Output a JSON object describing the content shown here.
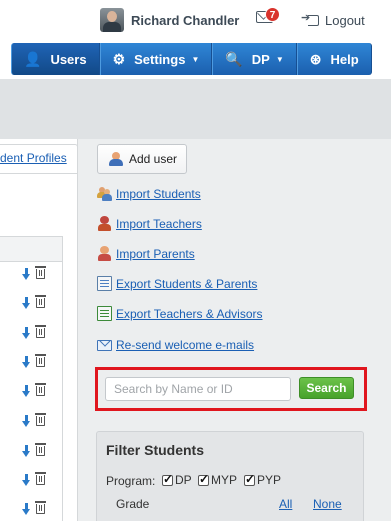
{
  "header": {
    "user_name": "Richard Chandler",
    "messages_badge": "7",
    "logout_label": "Logout"
  },
  "nav": {
    "items": [
      {
        "label": "Users",
        "icon": "user-icon"
      },
      {
        "label": "Settings",
        "icon": "gear-icon",
        "dropdown": true
      },
      {
        "label": "DP",
        "icon": "search-icon",
        "dropdown": true
      },
      {
        "label": "Help",
        "icon": "lifebuoy-icon"
      }
    ]
  },
  "left_panel": {
    "tab_label": "dent Profiles",
    "row_count": 9
  },
  "actions": {
    "add_user_label": "Add user",
    "links": [
      {
        "label": "Import Students",
        "icon": "people-icon"
      },
      {
        "label": "Import Teachers",
        "icon": "teacher-icon"
      },
      {
        "label": "Import Parents",
        "icon": "parent-icon"
      },
      {
        "label": "Export Students & Parents",
        "icon": "export-sheet-icon"
      },
      {
        "label": "Export Teachers & Advisors",
        "icon": "export-sheet-green-icon"
      },
      {
        "label": "Re-send welcome e-mails",
        "icon": "mail-icon"
      }
    ]
  },
  "search": {
    "placeholder": "Search by Name or ID",
    "value": "",
    "button_label": "Search"
  },
  "filter": {
    "title": "Filter Students",
    "program_label": "Program:",
    "programs": [
      {
        "label": "DP",
        "checked": true
      },
      {
        "label": "MYP",
        "checked": true
      },
      {
        "label": "PYP",
        "checked": true
      }
    ],
    "grade_label": "Grade",
    "grade_all": "All",
    "grade_none": "None"
  },
  "colors": {
    "nav_blue": "#1b5fae",
    "link_blue": "#1a5fb4",
    "search_green": "#47a22b",
    "highlight_red": "#e0161e",
    "badge_red": "#d9332c"
  }
}
